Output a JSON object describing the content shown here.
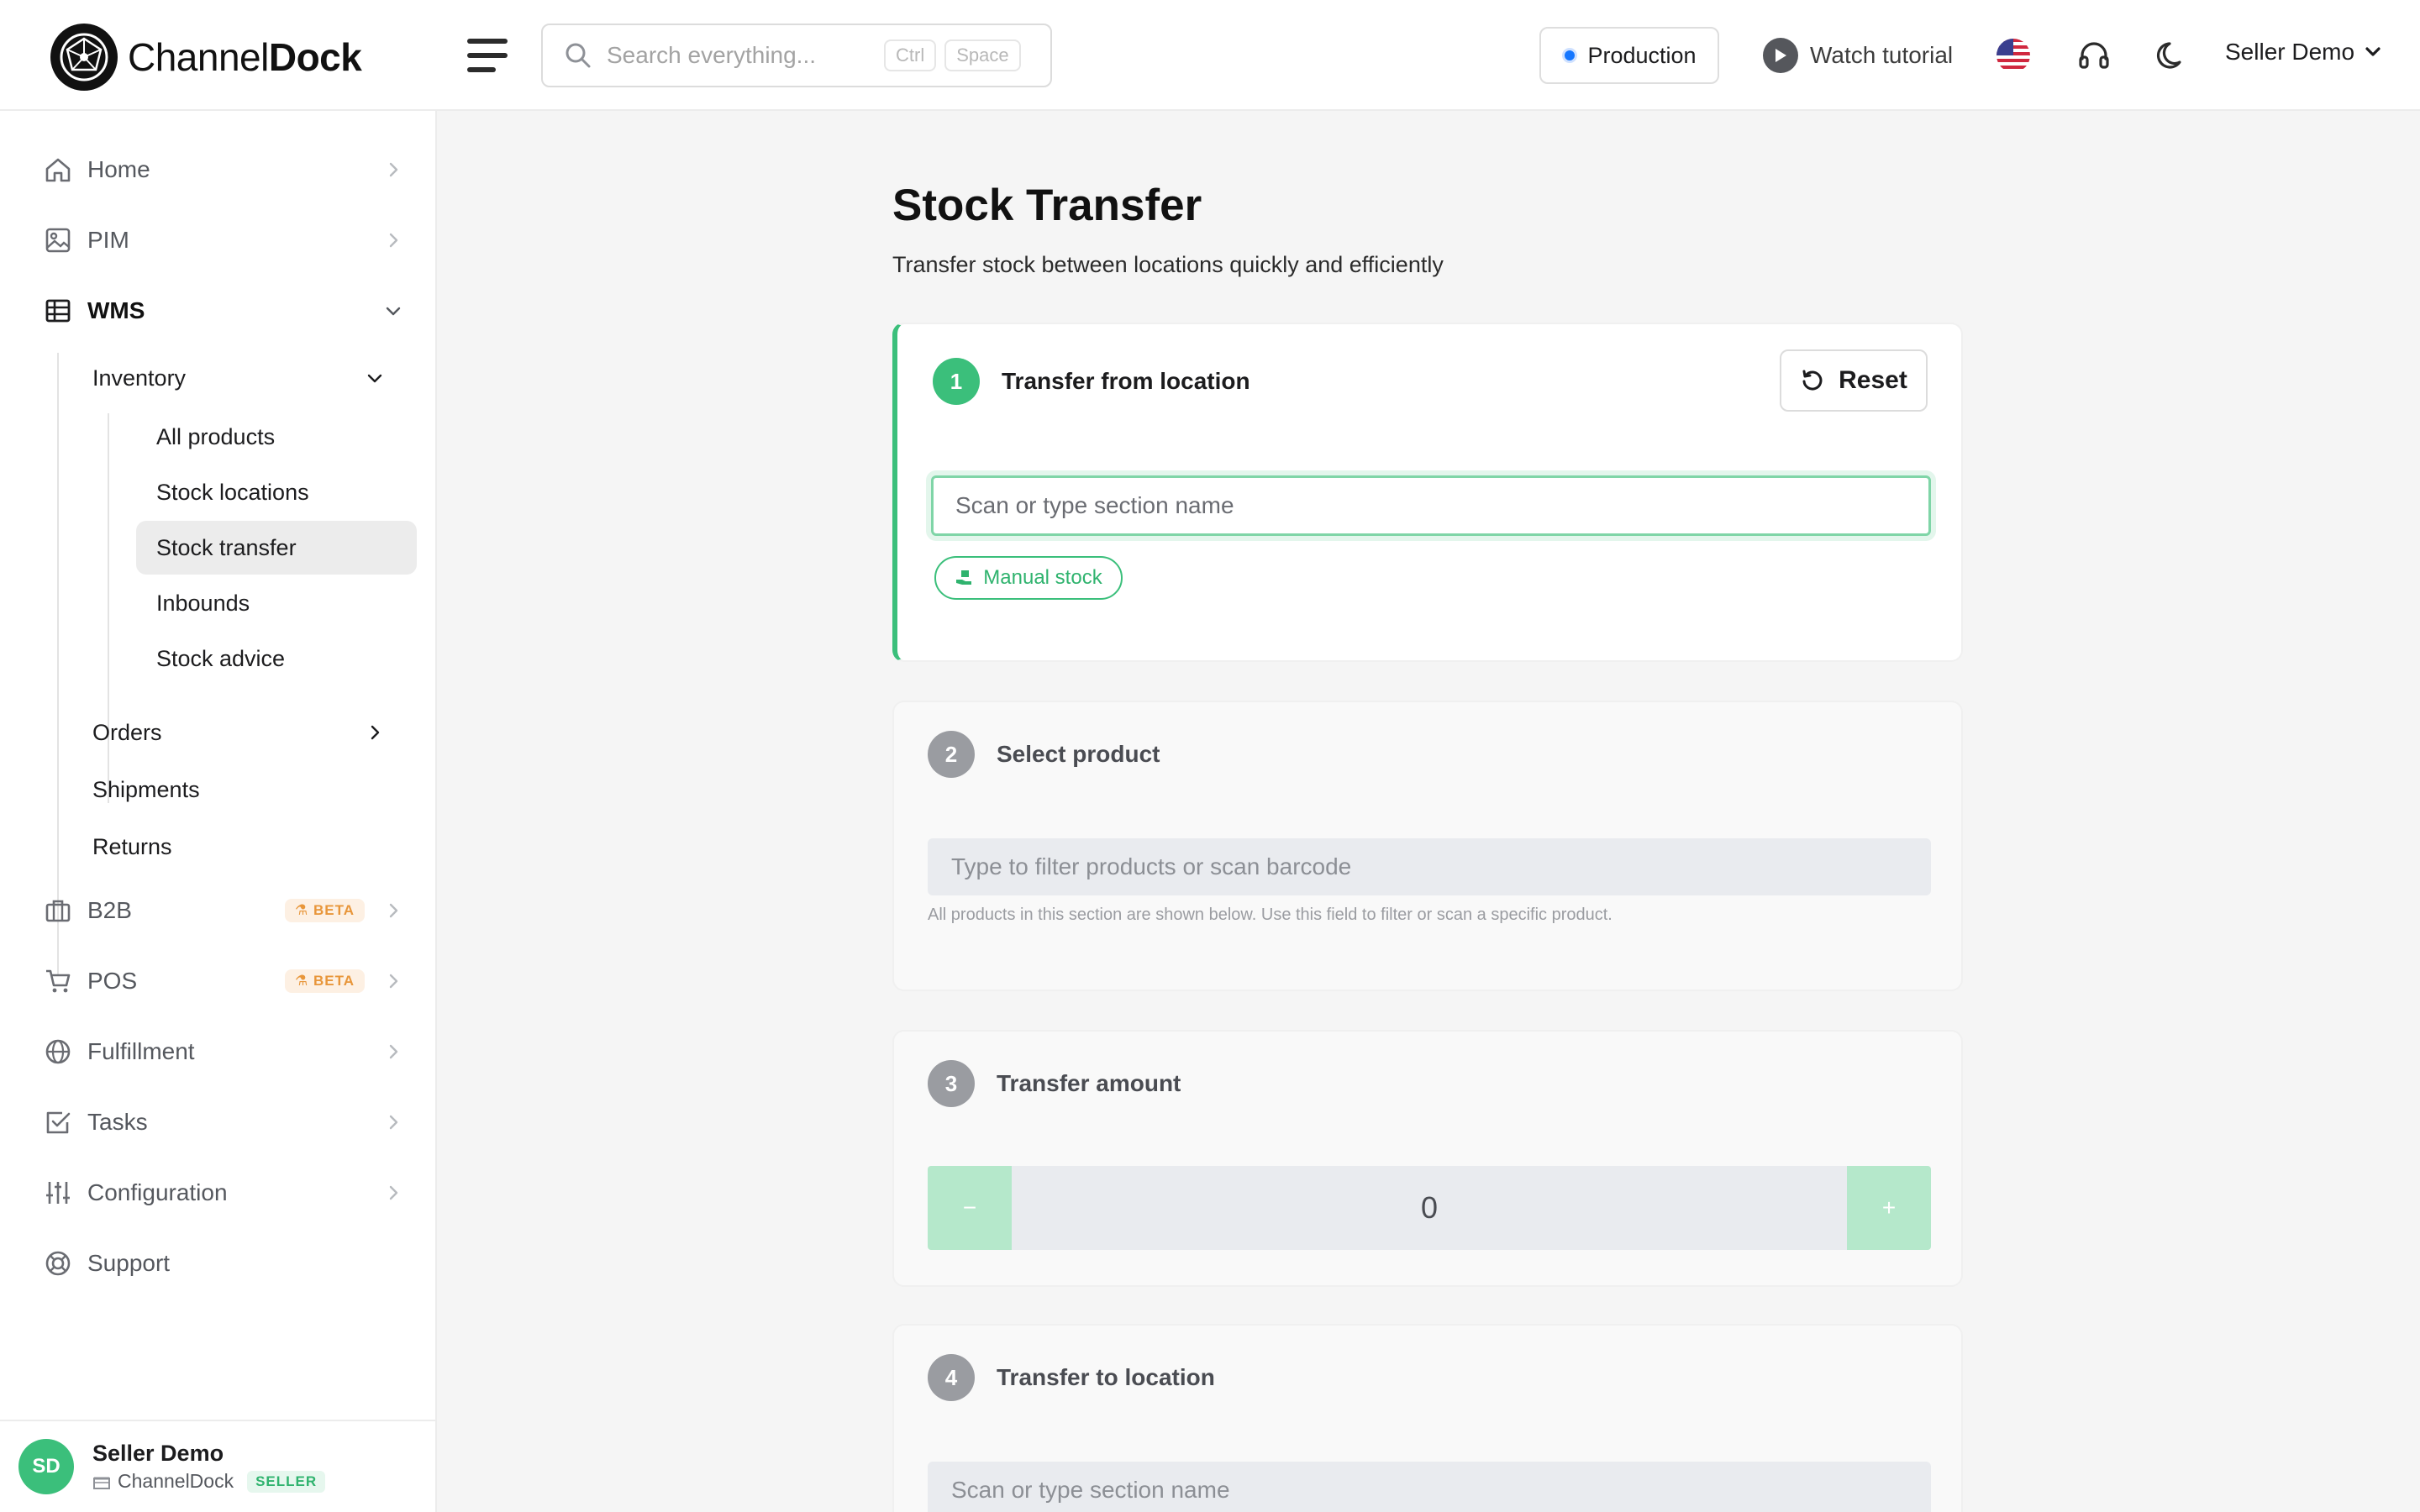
{
  "app": {
    "brand_part1": "Channel",
    "brand_part2": "Dock"
  },
  "header": {
    "search_placeholder": "Search everything...",
    "kbd_1": "Ctrl",
    "kbd_2": "Space",
    "environment": "Production",
    "tutorial_label": "Watch tutorial",
    "user_label": "Seller Demo",
    "icons": [
      "search-icon",
      "menu-icon",
      "play-icon",
      "us-flag-icon",
      "headset-icon",
      "moon-icon",
      "chevron-down-icon"
    ]
  },
  "sidebar": {
    "items": [
      {
        "label": "Home",
        "icon": "home-icon"
      },
      {
        "label": "PIM",
        "icon": "image-icon"
      },
      {
        "label": "WMS",
        "icon": "table-icon"
      },
      {
        "label": "B2B",
        "icon": "briefcase-icon",
        "badge": "BETA"
      },
      {
        "label": "POS",
        "icon": "cart-icon",
        "badge": "BETA"
      },
      {
        "label": "Fulfillment",
        "icon": "globe-icon"
      },
      {
        "label": "Tasks",
        "icon": "checkbox-icon"
      },
      {
        "label": "Configuration",
        "icon": "sliders-icon"
      },
      {
        "label": "Support",
        "icon": "lifebuoy-icon"
      }
    ],
    "wms_children": [
      {
        "label": "Inventory"
      },
      {
        "label": "Orders"
      },
      {
        "label": "Shipments"
      },
      {
        "label": "Returns"
      }
    ],
    "inventory_children": [
      {
        "label": "All products"
      },
      {
        "label": "Stock locations"
      },
      {
        "label": "Stock transfer"
      },
      {
        "label": "Inbounds"
      },
      {
        "label": "Stock advice"
      }
    ],
    "footer": {
      "initials": "SD",
      "name": "Seller Demo",
      "company": "ChannelDock",
      "role_badge": "SELLER"
    }
  },
  "main": {
    "title": "Stock Transfer",
    "subtitle": "Transfer stock between locations quickly and efficiently",
    "steps": [
      {
        "number": "1",
        "title": "Transfer from location",
        "reset_label": "Reset",
        "input_placeholder": "Scan or type section name",
        "manual_label": "Manual stock"
      },
      {
        "number": "2",
        "title": "Select product",
        "input_placeholder": "Type to filter products or scan barcode",
        "helper": "All products in this section are shown below. Use this field to filter or scan a specific product."
      },
      {
        "number": "3",
        "title": "Transfer amount",
        "minus": "−",
        "plus": "+",
        "value": "0"
      },
      {
        "number": "4",
        "title": "Transfer to location",
        "input_placeholder": "Scan or type section name"
      }
    ]
  },
  "colors": {
    "accent_green": "#3bbf7b",
    "beta_orange": "#e8963a",
    "env_dot_blue": "#1677ff"
  }
}
